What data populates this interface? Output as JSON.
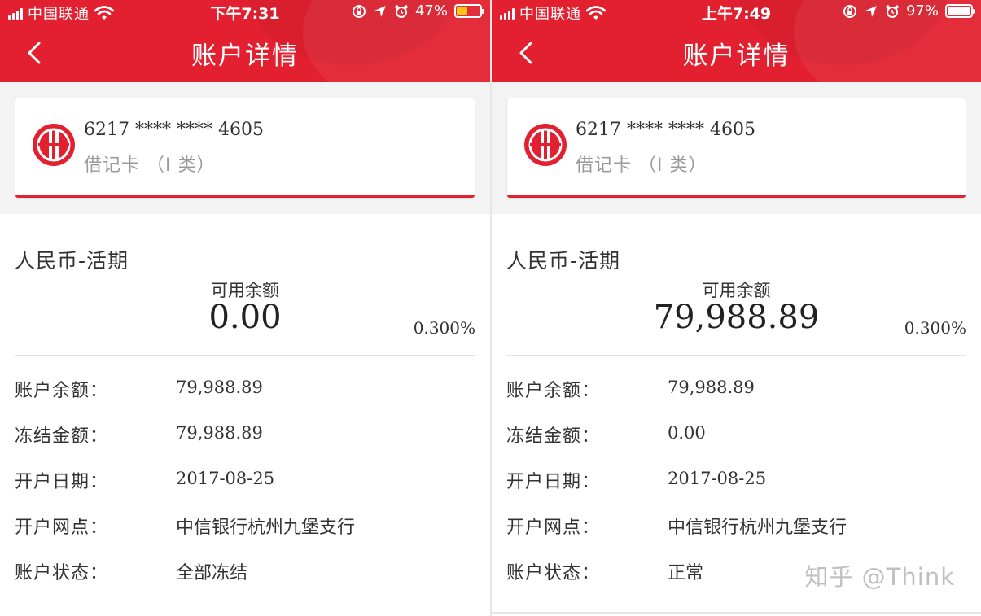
{
  "left": {
    "status": {
      "carrier": "中国联通",
      "time": "下午7:31",
      "battery_pct": "47%",
      "battery_fill": 0.47
    },
    "nav": {
      "title": "账户详情"
    },
    "card": {
      "number": "6217 **** **** 4605",
      "type": "借记卡 （I 类）"
    },
    "currency": "人民币-活期",
    "available": {
      "label": "可用余额",
      "amount": "0.00",
      "rate": "0.300%"
    },
    "rows": [
      {
        "label": "账户余额：",
        "value": "79,988.89"
      },
      {
        "label": "冻结金额：",
        "value": "79,988.89"
      },
      {
        "label": "开户日期：",
        "value": "2017-08-25"
      },
      {
        "label": "开户网点：",
        "value": "中信银行杭州九堡支行"
      },
      {
        "label": "账户状态：",
        "value": "全部冻结"
      }
    ]
  },
  "right": {
    "status": {
      "carrier": "中国联通",
      "time": "上午7:49",
      "battery_pct": "97%",
      "battery_fill": 0.97
    },
    "nav": {
      "title": "账户详情"
    },
    "card": {
      "number": "6217 **** **** 4605",
      "type": "借记卡 （I 类）"
    },
    "currency": "人民币-活期",
    "available": {
      "label": "可用余额",
      "amount": "79,988.89",
      "rate": "0.300%"
    },
    "rows": [
      {
        "label": "账户余额：",
        "value": "79,988.89"
      },
      {
        "label": "冻结金额：",
        "value": "0.00"
      },
      {
        "label": "开户日期：",
        "value": "2017-08-25"
      },
      {
        "label": "开户网点：",
        "value": "中信银行杭州九堡支行"
      },
      {
        "label": "账户状态：",
        "value": "正常"
      }
    ]
  },
  "watermark": "知乎 @Think",
  "colors": {
    "brand_red": "#e2202f",
    "battery_low": "#f5c518",
    "battery_full": "#ffffff"
  },
  "icons": [
    "signal-icon",
    "wifi-icon",
    "lock-rotation-icon",
    "location-icon",
    "alarm-icon",
    "battery-icon",
    "back-chevron-icon",
    "citic-logo-icon"
  ]
}
